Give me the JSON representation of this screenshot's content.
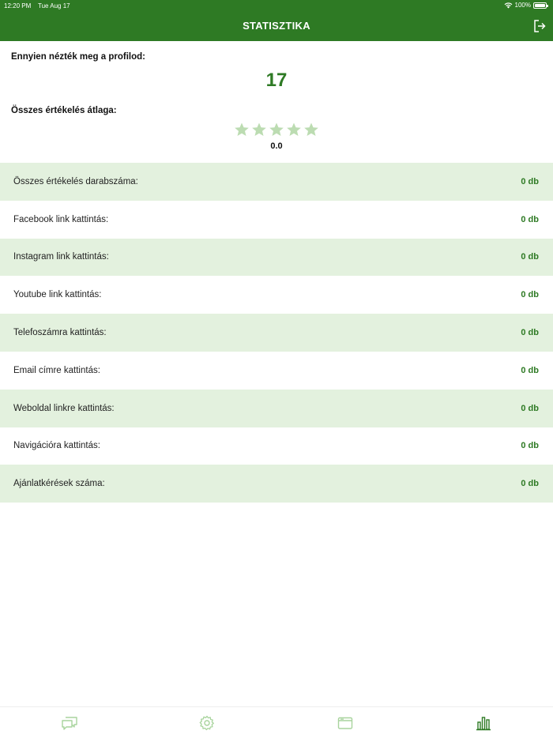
{
  "status_bar": {
    "time": "12:20 PM",
    "date": "Tue Aug 17",
    "battery": "100%"
  },
  "header": {
    "title": "STATISZTIKA"
  },
  "views": {
    "label": "Ennyien nézték meg a profilod:",
    "count": "17"
  },
  "rating": {
    "label": "Összes értékelés átlaga:",
    "value": "0.0",
    "stars_total": 5,
    "stars_filled": 0
  },
  "stats": [
    {
      "label": "Összes értékelés darabszáma:",
      "value": "0 db"
    },
    {
      "label": "Facebook link kattintás:",
      "value": "0 db"
    },
    {
      "label": "Instagram link kattintás:",
      "value": "0 db"
    },
    {
      "label": "Youtube link kattintás:",
      "value": "0 db"
    },
    {
      "label": "Telefoszámra kattintás:",
      "value": "0 db"
    },
    {
      "label": "Email címre kattintás:",
      "value": "0 db"
    },
    {
      "label": "Weboldal linkre kattintás:",
      "value": "0 db"
    },
    {
      "label": "Navigációra kattintás:",
      "value": "0 db"
    },
    {
      "label": "Ajánlatkérések száma:",
      "value": "0 db"
    }
  ],
  "tabbar": {
    "tabs": [
      {
        "icon": "chat-icon",
        "active": false
      },
      {
        "icon": "gear-icon",
        "active": false
      },
      {
        "icon": "browser-window-icon",
        "active": false
      },
      {
        "icon": "bar-chart-icon",
        "active": true
      }
    ]
  },
  "colors": {
    "primary": "#2e7a24",
    "row_alt": "#e3f1de",
    "star_empty": "#bcdcb2",
    "tab_inactive": "#a8d49d"
  }
}
